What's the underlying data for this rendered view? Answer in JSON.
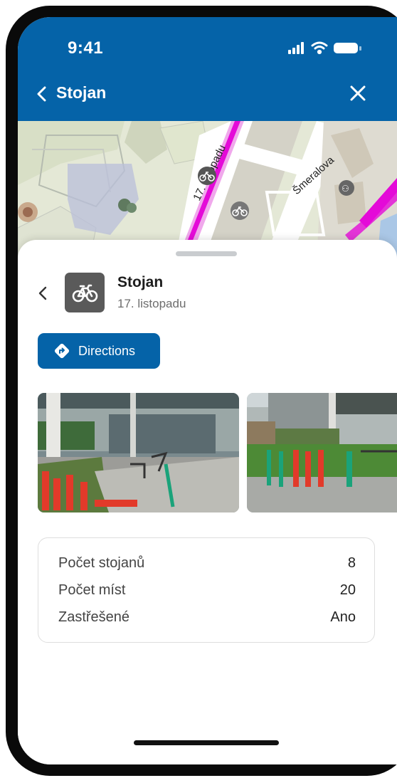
{
  "status_bar": {
    "time": "9:41"
  },
  "nav": {
    "title": "Stojan"
  },
  "map": {
    "street_1": "17. listopadu",
    "street_2": "Šmeralova"
  },
  "detail": {
    "title": "Stojan",
    "subtitle": "17. listopadu",
    "directions_label": "Directions"
  },
  "info": {
    "rows": [
      {
        "label": "Počet stojanů",
        "value": "8"
      },
      {
        "label": "Počet míst",
        "value": "20"
      },
      {
        "label": "Zastřešené",
        "value": "Ano"
      }
    ]
  },
  "colors": {
    "brand": "#0563a8",
    "route": "#e40ad8"
  },
  "icons": [
    "back-icon",
    "close-icon",
    "bicycle-icon",
    "directions-icon",
    "signal-icon",
    "wifi-icon",
    "battery-icon"
  ]
}
